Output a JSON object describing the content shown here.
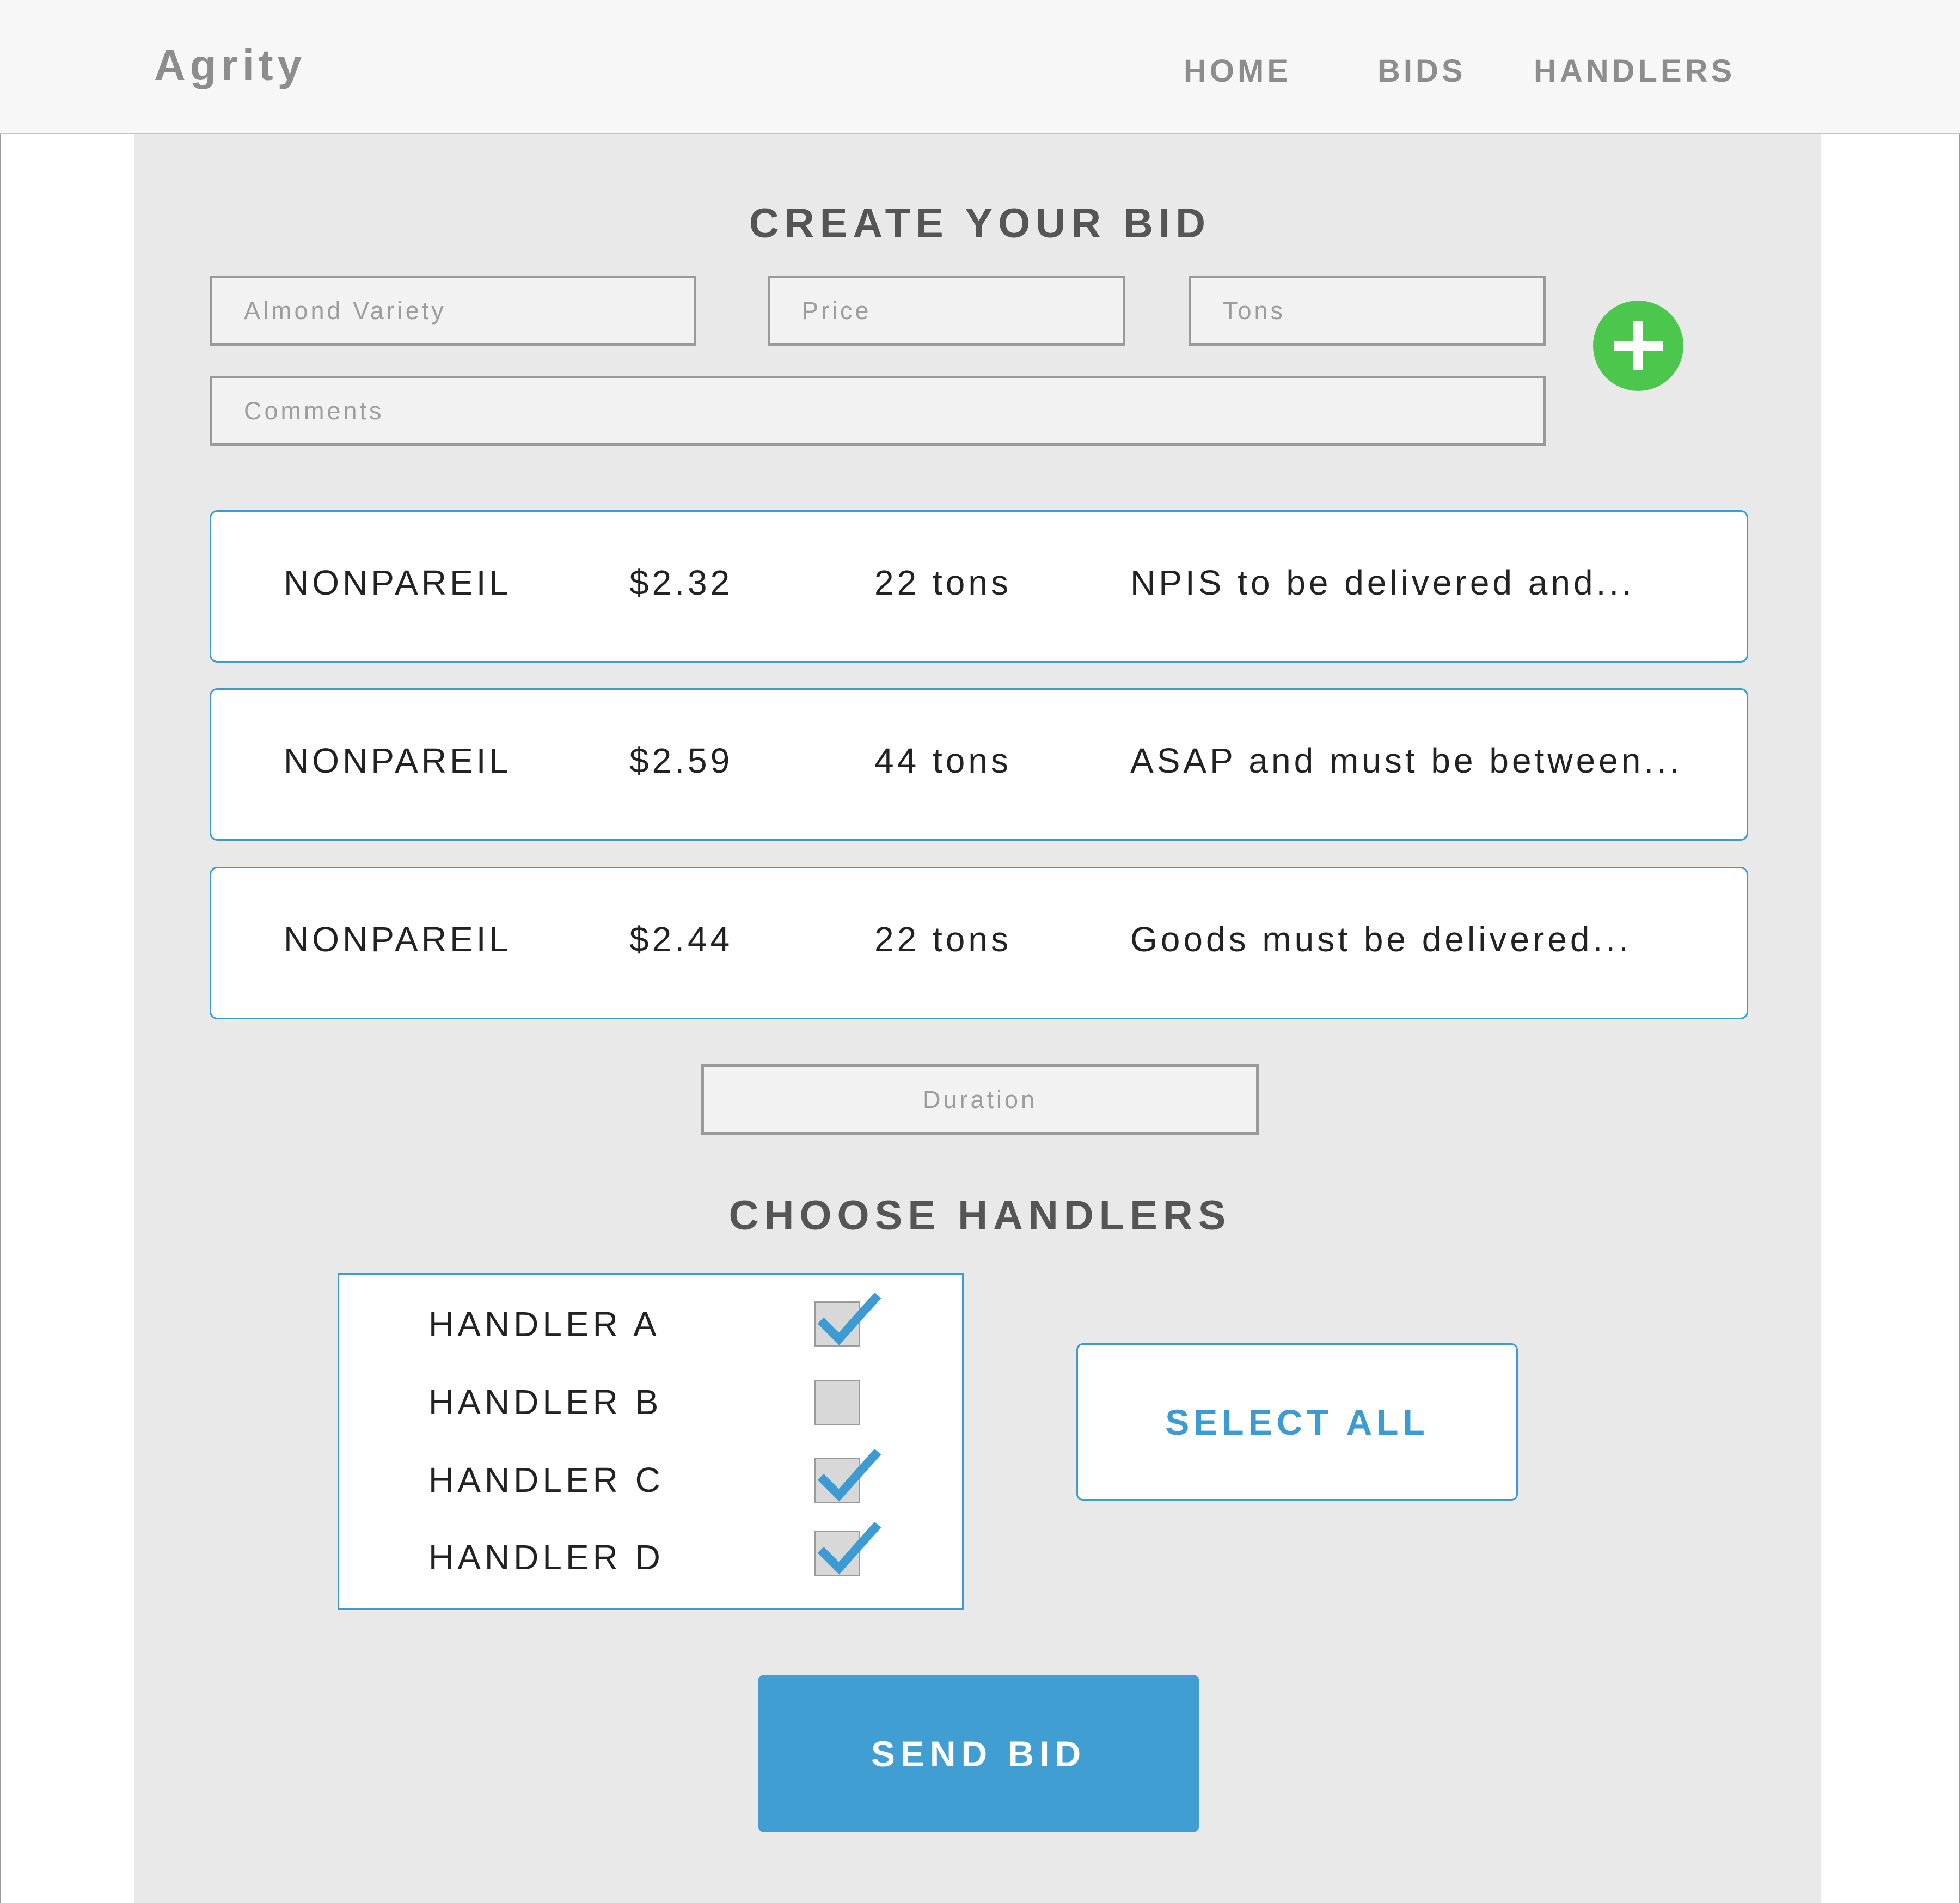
{
  "nav": {
    "logo": "Agrity",
    "links": [
      "HOME",
      "BIDS",
      "HANDLERS"
    ]
  },
  "create": {
    "heading": "CREATE YOUR BID",
    "variety_placeholder": "Almond Variety",
    "price_placeholder": "Price",
    "tons_placeholder": "Tons",
    "comments_placeholder": "Comments",
    "add_icon": "plus-icon",
    "add_color": "#4dc64d"
  },
  "bids": [
    {
      "variety": "NONPAREIL",
      "price": "$2.32",
      "tons": "22 tons",
      "comment": "NPIS to be delivered and..."
    },
    {
      "variety": "NONPAREIL",
      "price": "$2.59",
      "tons": "44 tons",
      "comment": "ASAP and must be between..."
    },
    {
      "variety": "NONPAREIL",
      "price": "$2.44",
      "tons": "22 tons",
      "comment": "Goods must be delivered..."
    }
  ],
  "duration_placeholder": "Duration",
  "handlers": {
    "heading": "CHOOSE HANDLERS",
    "items": [
      {
        "label": "HANDLER A",
        "checked": true
      },
      {
        "label": "HANDLER B",
        "checked": false
      },
      {
        "label": "HANDLER C",
        "checked": true
      },
      {
        "label": "HANDLER D",
        "checked": true
      }
    ],
    "select_all": "SELECT ALL"
  },
  "send_bid": "SEND BID",
  "colors": {
    "accent": "#409ed2",
    "add": "#4dc64d",
    "panel": "#e9e9e9"
  }
}
